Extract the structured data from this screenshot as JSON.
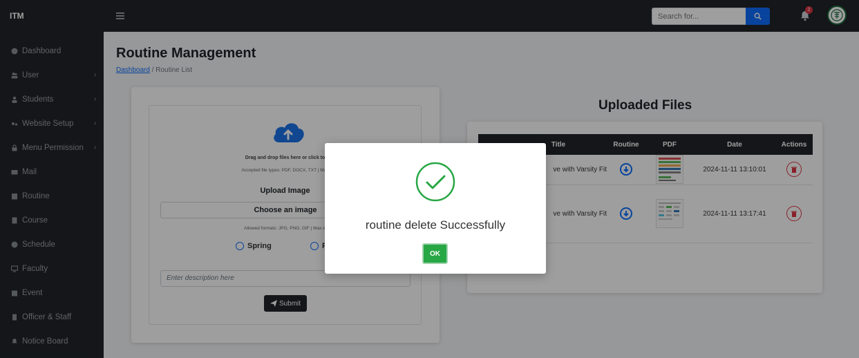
{
  "topbar": {
    "brand": "ITM",
    "search_placeholder": "Search for...",
    "notification_count": "2"
  },
  "sidebar": {
    "items": [
      {
        "label": "Dashboard",
        "icon": "dashboard-icon",
        "has_chevron": false
      },
      {
        "label": "User",
        "icon": "users-icon",
        "has_chevron": true
      },
      {
        "label": "Students",
        "icon": "student-icon",
        "has_chevron": true
      },
      {
        "label": "Website Setup",
        "icon": "sliders-icon",
        "has_chevron": true
      },
      {
        "label": "Menu Permission",
        "icon": "lock-icon",
        "has_chevron": true
      },
      {
        "label": "Mail",
        "icon": "mail-icon",
        "has_chevron": false
      },
      {
        "label": "Routine",
        "icon": "calendar-icon",
        "has_chevron": false
      },
      {
        "label": "Course",
        "icon": "book-icon",
        "has_chevron": false
      },
      {
        "label": "Schedule",
        "icon": "clock-icon",
        "has_chevron": false
      },
      {
        "label": "Faculty",
        "icon": "faculty-icon",
        "has_chevron": false
      },
      {
        "label": "Event",
        "icon": "event-icon",
        "has_chevron": false
      },
      {
        "label": "Officer & Staff",
        "icon": "staff-icon",
        "has_chevron": false
      },
      {
        "label": "Notice Board",
        "icon": "bell-icon",
        "has_chevron": false
      }
    ]
  },
  "page": {
    "title": "Routine Management",
    "breadcrumb_link": "Dashboard",
    "breadcrumb_sep": "/",
    "breadcrumb_current": "Routine List"
  },
  "upload": {
    "drop_text": "Drag and drop files here or click to",
    "accepted_text": "Accepted file types: PDF, DOCX, TXT | Max",
    "upload_label": "Upload Image",
    "choose_label": "Choose an image",
    "allowed_text": "Allowed formats: JPG, PNG, GIF | Max si",
    "radio_spring": "Spring",
    "radio_second": "F",
    "description_placeholder": "Enter description here",
    "submit_label": "Submit"
  },
  "files": {
    "title": "Uploaded Files",
    "columns": [
      "Title",
      "Routine",
      "PDF",
      "Date",
      "Actions"
    ],
    "rows": [
      {
        "title": "ve with Varsity Fit",
        "date": "2024-11-11 13:10:01"
      },
      {
        "title": "ve with Varsity Fit",
        "date": "2024-11-11 13:17:41"
      }
    ]
  },
  "modal": {
    "message": "routine delete Successfully",
    "ok_label": "OK"
  },
  "colors": {
    "sidebar_bg": "#212529",
    "primary": "#0d6efd",
    "success": "#28a745",
    "danger": "#dc3545"
  }
}
